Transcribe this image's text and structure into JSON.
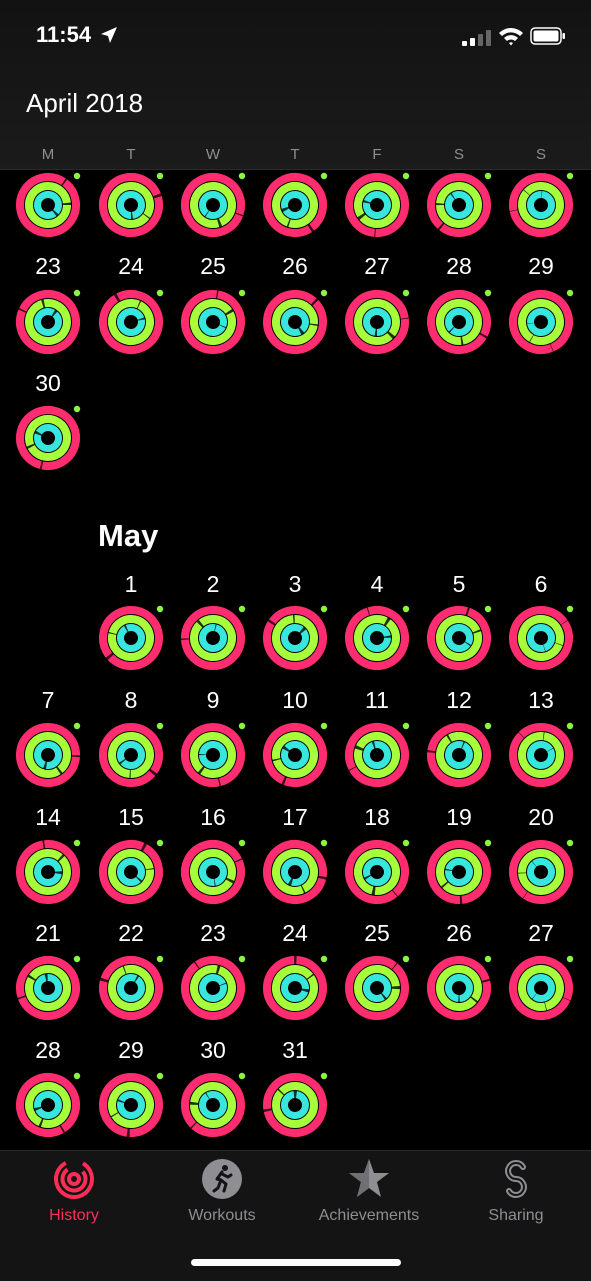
{
  "status_bar": {
    "time": "11:54"
  },
  "header": {
    "title": "April 2018",
    "weekdays": [
      "M",
      "T",
      "W",
      "T",
      "F",
      "S",
      "S"
    ]
  },
  "calendar": {
    "april_partial_week": [
      "",
      "",
      "",
      "",
      "",
      "",
      ""
    ],
    "april_week_4": [
      "23",
      "24",
      "25",
      "26",
      "27",
      "28",
      "29"
    ],
    "april_week_5": [
      "30"
    ],
    "may": {
      "title": "May",
      "week_1": [
        "1",
        "2",
        "3",
        "4",
        "5",
        "6"
      ],
      "week_2": [
        "7",
        "8",
        "9",
        "10",
        "11",
        "12",
        "13"
      ],
      "week_3": [
        "14",
        "15",
        "16",
        "17",
        "18",
        "19",
        "20"
      ],
      "week_4": [
        "21",
        "22",
        "23",
        "24",
        "25",
        "26",
        "27"
      ],
      "week_5": [
        "28",
        "29",
        "30",
        "31"
      ]
    }
  },
  "ring_colors": {
    "move": "#ff2d6f",
    "exercise": "#a6ff3a",
    "stand": "#37e6dd",
    "track_move": "#3a0c18",
    "dot": "#8cf540"
  },
  "tabs": [
    {
      "label": "History",
      "icon": "history-rings-icon",
      "active": true
    },
    {
      "label": "Workouts",
      "icon": "runner-icon",
      "active": false
    },
    {
      "label": "Achievements",
      "icon": "star-icon",
      "active": false
    },
    {
      "label": "Sharing",
      "icon": "sharing-s-icon",
      "active": false
    }
  ],
  "colors": {
    "accent": "#ff2d55",
    "inactive": "#8e8e93"
  }
}
